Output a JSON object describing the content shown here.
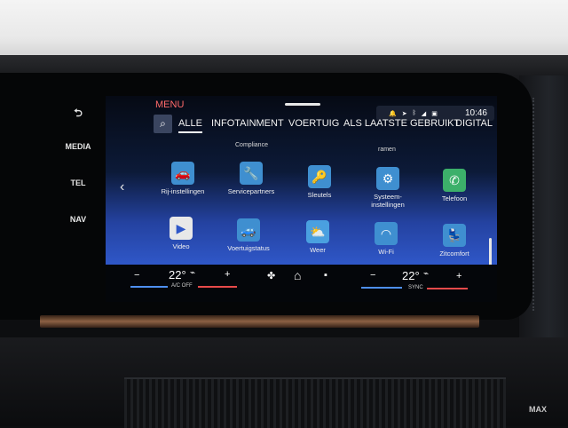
{
  "hardware_buttons": {
    "back": "⮌",
    "media": "MEDIA",
    "tel": "TEL",
    "nav": "NAV"
  },
  "header": {
    "menu_title": "MENU",
    "clock": "10:46"
  },
  "tabs": [
    {
      "label": "ALLE",
      "active": true
    },
    {
      "label": "INFOTAINMENT",
      "active": false
    },
    {
      "label": "VOERTUIG",
      "active": false
    },
    {
      "label": "ALS LAATSTE GEBRUIKT",
      "active": false
    },
    {
      "label": "DIGITAL",
      "active": false
    }
  ],
  "partial_labels": {
    "compliance": "Compliance",
    "ramen": "ramen"
  },
  "apps": [
    {
      "label": "Rij-instellingen",
      "icon": "car-icon",
      "color": "#3f8fd0"
    },
    {
      "label": "Servicepartners",
      "icon": "wrench-icon",
      "color": "#3f8fd0"
    },
    {
      "label": "Sleutels",
      "icon": "key-icon",
      "color": "#3f8fd0"
    },
    {
      "label": "Systeem-instellingen",
      "icon": "gear-icon",
      "color": "#3f8fd0"
    },
    {
      "label": "Telefoon",
      "icon": "phone-icon",
      "color": "#3cb06a"
    },
    {
      "label": "Video",
      "icon": "video-icon",
      "color": "#e8e8e8"
    },
    {
      "label": "Voertuigstatus",
      "icon": "vehicle-status-icon",
      "color": "#3f8fd0"
    },
    {
      "label": "Weer",
      "icon": "weather-icon",
      "color": "#4aa0e0"
    },
    {
      "label": "Wi-Fi",
      "icon": "wifi-icon",
      "color": "#3f8fd0"
    },
    {
      "label": "Zitcomfort",
      "icon": "seat-icon",
      "color": "#3f8fd0"
    }
  ],
  "climate": {
    "left_minus": "−",
    "left_temp": "22°",
    "left_mode": "A/C OFF",
    "left_plus": "+",
    "right_minus": "−",
    "right_temp": "22°",
    "right_mode": "SYNC",
    "right_plus": "+"
  },
  "badge": "MAX"
}
